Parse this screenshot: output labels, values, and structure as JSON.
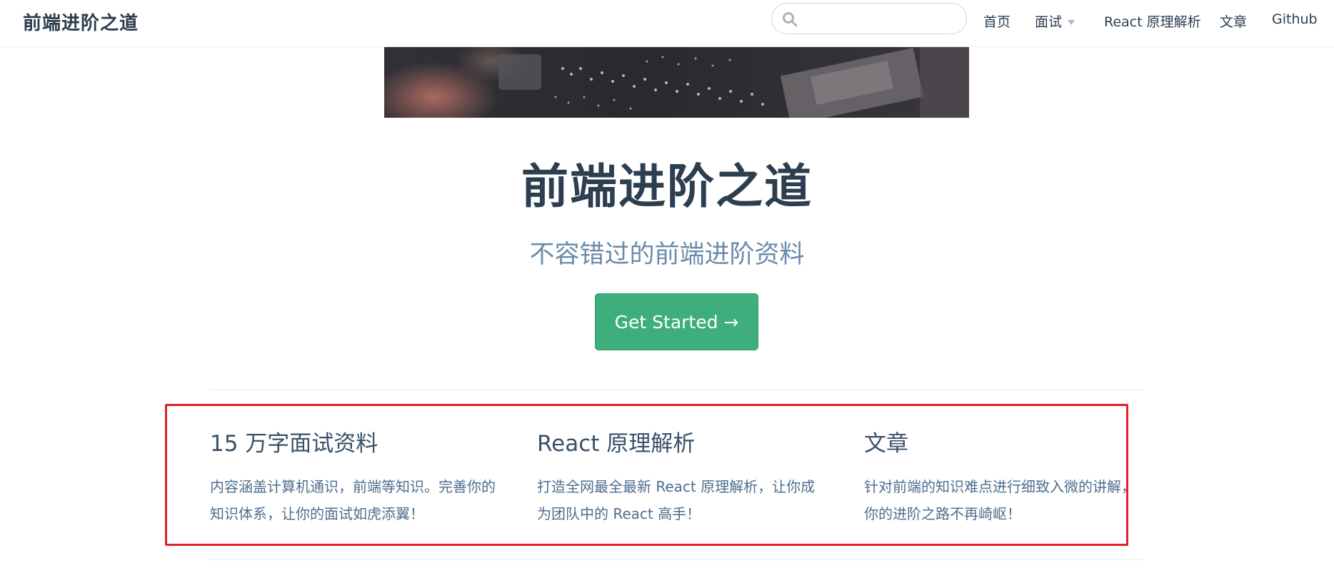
{
  "navbar": {
    "site_name": "前端进阶之道",
    "search": {
      "placeholder": "",
      "value": ""
    },
    "links": [
      {
        "label": "首页",
        "has_dropdown": false
      },
      {
        "label": "面试",
        "has_dropdown": true
      },
      {
        "label": "React 原理解析",
        "has_dropdown": false
      },
      {
        "label": "文章",
        "has_dropdown": false
      },
      {
        "label": "Github",
        "has_dropdown": false
      }
    ]
  },
  "hero": {
    "title": "前端进阶之道",
    "tagline": "不容错过的前端进阶资料",
    "action_label": "Get Started →"
  },
  "features": [
    {
      "title": "15 万字面试资料",
      "description": "内容涵盖计算机通识，前端等知识。完善你的知识体系，让你的面试如虎添翼！"
    },
    {
      "title": "React 原理解析",
      "description": "打造全网最全最新 React 原理解析，让你成为团队中的 React 高手！"
    },
    {
      "title": "文章",
      "description": "针对前端的知识难点进行细致入微的讲解，让你的进阶之路不再崎岖！"
    }
  ],
  "colors": {
    "accent": "#3eaf7c",
    "text": "#2c3e50",
    "tagline": "#6a8bad",
    "highlight_border": "#e0212b"
  }
}
